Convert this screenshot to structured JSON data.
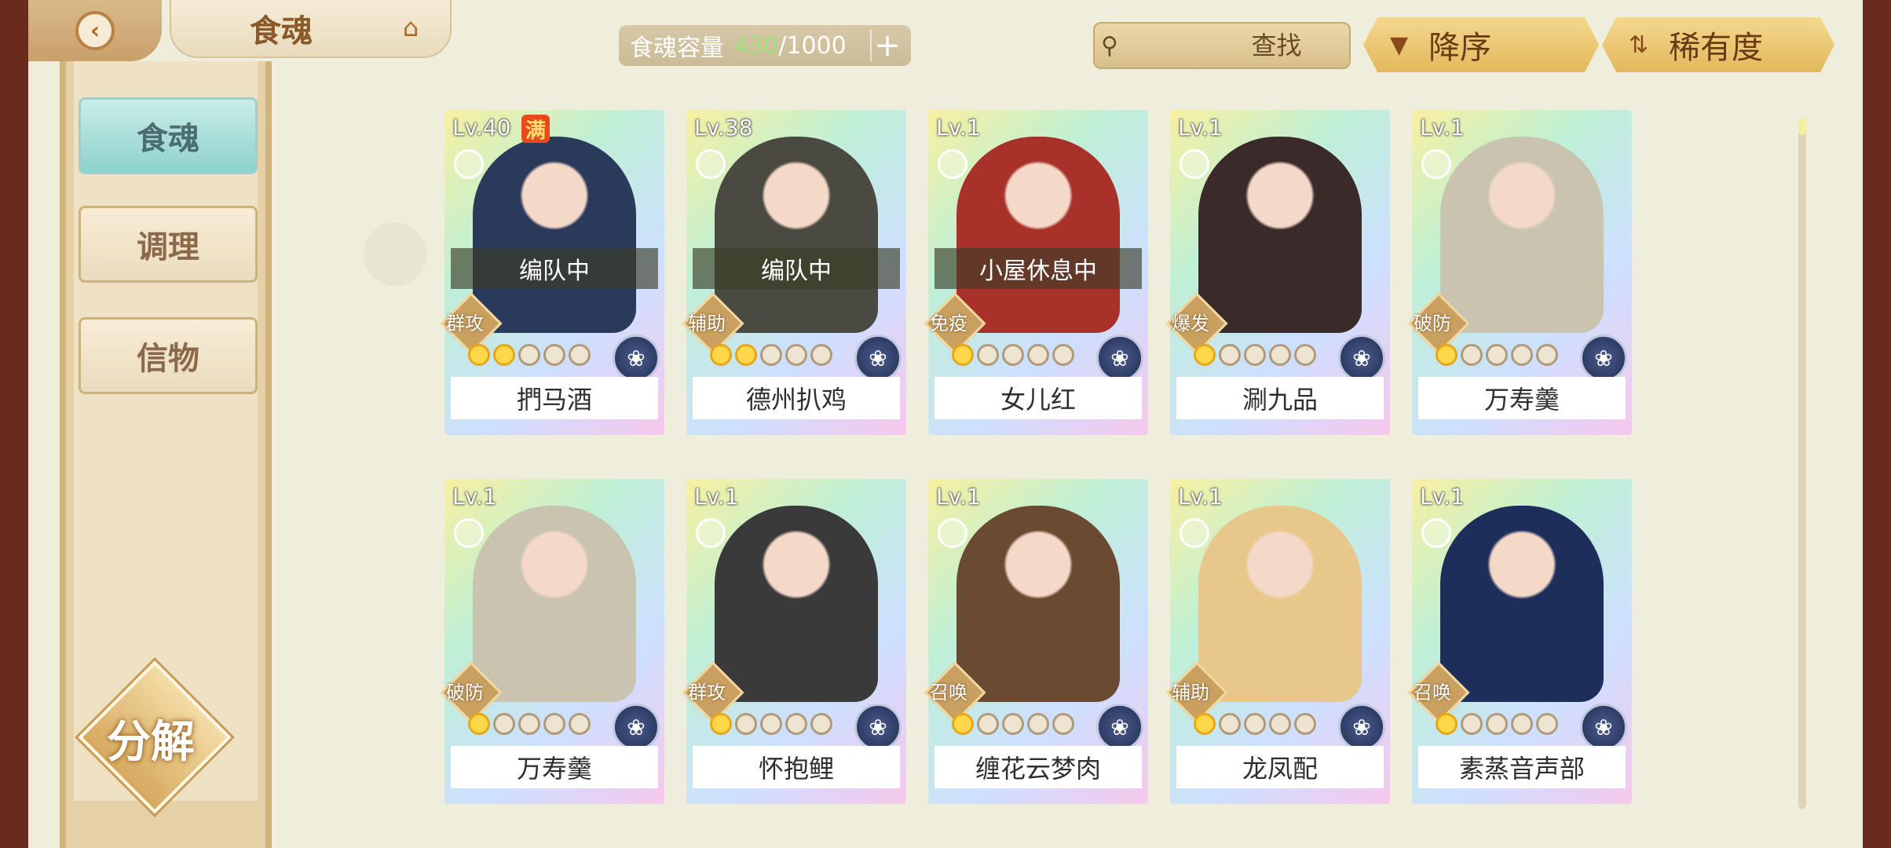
{
  "header": {
    "back_icon": "back-chevron-icon",
    "title": "食魂",
    "home_icon": "pagoda-icon",
    "capacity_label": "食魂容量",
    "capacity_current": "430",
    "capacity_max": "/1000",
    "capacity_add": "+",
    "search_placeholder": "查找",
    "clear_label": "✕",
    "sort_order_label": "降序",
    "sort_key_label": "稀有度"
  },
  "sidebar": {
    "items": [
      {
        "label": "食魂",
        "active": true
      },
      {
        "label": "调理",
        "active": false
      },
      {
        "label": "信物",
        "active": false
      }
    ],
    "decompose_label": "分解"
  },
  "cards": [
    {
      "level": "Lv.40",
      "full": "满",
      "status": "编队中",
      "role": "群攻",
      "name": "捫马酒",
      "stars": 2,
      "tint": "#2a3a5a"
    },
    {
      "level": "Lv.38",
      "full": "",
      "status": "编队中",
      "role": "辅助",
      "name": "德州扒鸡",
      "stars": 2,
      "tint": "#4a4a40"
    },
    {
      "level": "Lv.1",
      "full": "",
      "status": "小屋休息中",
      "role": "免疫",
      "name": "女儿红",
      "stars": 1,
      "tint": "#a8322a"
    },
    {
      "level": "Lv.1",
      "full": "",
      "status": "",
      "role": "爆发",
      "name": "涮九品",
      "stars": 1,
      "tint": "#3a2a2a"
    },
    {
      "level": "Lv.1",
      "full": "",
      "status": "",
      "role": "破防",
      "name": "万寿羹",
      "stars": 1,
      "tint": "#c9c4b0"
    },
    {
      "level": "Lv.1",
      "full": "",
      "status": "",
      "role": "破防",
      "name": "万寿羹",
      "stars": 1,
      "tint": "#c9c4b0"
    },
    {
      "level": "Lv.1",
      "full": "",
      "status": "",
      "role": "群攻",
      "name": "怀抱鲤",
      "stars": 1,
      "tint": "#3a3a3a"
    },
    {
      "level": "Lv.1",
      "full": "",
      "status": "",
      "role": "召唤",
      "name": "缠花云梦肉",
      "stars": 1,
      "tint": "#6a4a30"
    },
    {
      "level": "Lv.1",
      "full": "",
      "status": "",
      "role": "辅助",
      "name": "龙凤配",
      "stars": 1,
      "tint": "#e8c88a"
    },
    {
      "level": "Lv.1",
      "full": "",
      "status": "",
      "role": "召唤",
      "name": "素蒸音声部",
      "stars": 1,
      "tint": "#1e2e5a"
    }
  ]
}
